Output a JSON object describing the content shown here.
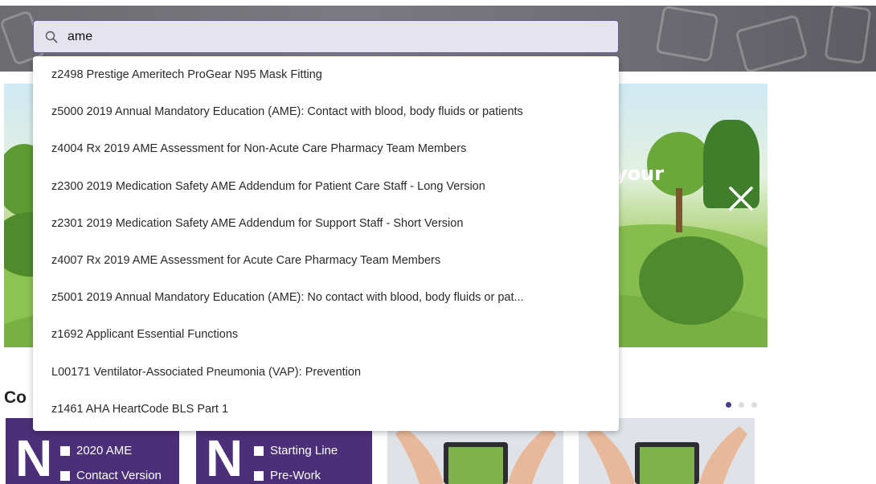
{
  "search": {
    "value": "ame",
    "icon": "search-icon"
  },
  "suggestions": [
    "z2498 Prestige Ameritech ProGear N95 Mask Fitting",
    "z5000 2019 Annual Mandatory Education (AME): Contact with blood, body fluids or patients",
    "z4004 Rx 2019 AME Assessment for Non-Acute Care Pharmacy Team Members",
    "z2300 2019 Medication Safety AME Addendum for Patient Care Staff - Long Version",
    "z2301 2019 Medication Safety AME Addendum for Support Staff - Short Version",
    "z4007 Rx 2019 AME Assessment for Acute Care Pharmacy Team Members",
    "z5001 2019 Annual Mandatory Education (AME): No contact with blood, body fluids or pat...",
    "z1692 Applicant Essential Functions",
    "L00171 Ventilator-Associated Pneumonia (VAP): Prevention",
    "z1461 AHA HeartCode BLS Part 1"
  ],
  "hero": {
    "partial_text": "your",
    "close_icon": "close-icon"
  },
  "section": {
    "title_partial": "Co"
  },
  "carousel": {
    "pages": 3,
    "active_page": 1
  },
  "cards": [
    {
      "logo": "N",
      "lines": [
        "2020 AME",
        "Contact Version"
      ]
    },
    {
      "logo": "N",
      "lines": [
        "Starting Line",
        "Pre-Work"
      ]
    }
  ],
  "colors": {
    "accent": "#4b2f78",
    "search_border": "#6a5aa8",
    "active_dot": "#4a3b8a"
  }
}
